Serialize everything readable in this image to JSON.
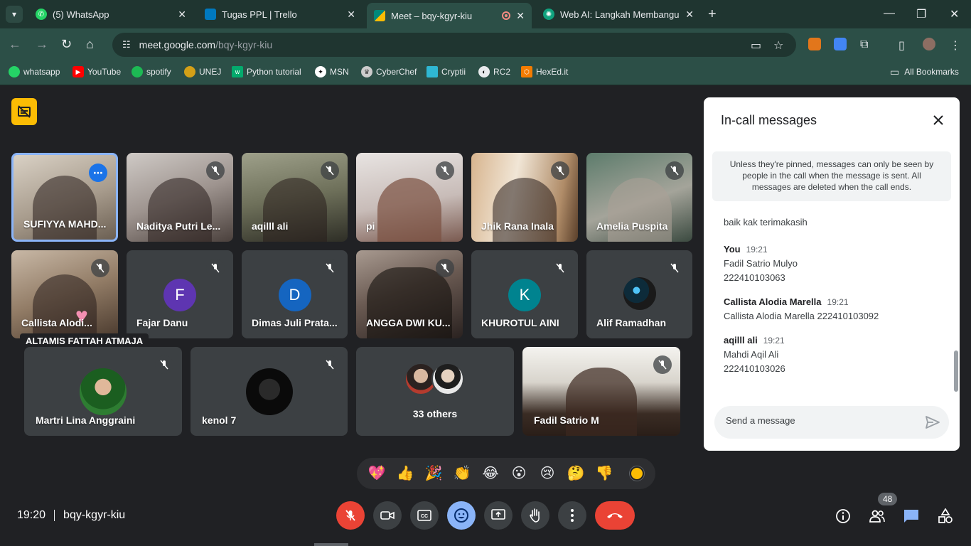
{
  "browser": {
    "tabs": [
      {
        "title": "(5) WhatsApp",
        "icon": "whatsapp-icon",
        "color": "#25d366"
      },
      {
        "title": "Tugas PPL | Trello",
        "icon": "trello-icon",
        "color": "#0079bf"
      },
      {
        "title": "Meet – bqy-kgyr-kiu",
        "icon": "meet-icon",
        "color": "#00897b"
      },
      {
        "title": "Web AI: Langkah Membangun",
        "icon": "openai-icon",
        "color": "#10a37f"
      }
    ],
    "url": {
      "host": "meet.google.com",
      "path": "/bqy-kgyr-kiu"
    },
    "bookmarks": [
      {
        "label": "whatsapp",
        "color": "#25d366"
      },
      {
        "label": "YouTube",
        "color": "#ff0000"
      },
      {
        "label": "spotify",
        "color": "#1db954"
      },
      {
        "label": "UNEJ",
        "color": "#d4a017"
      },
      {
        "label": "Python tutorial",
        "color": "#04aa6d"
      },
      {
        "label": "MSN",
        "color": "#ffffff"
      },
      {
        "label": "CyberChef",
        "color": "#cccccc"
      },
      {
        "label": "Cryptii",
        "color": "#2fb7d3"
      },
      {
        "label": "RC2",
        "color": "#e8eaed"
      },
      {
        "label": "HexEd.it",
        "color": "#f57c00"
      }
    ],
    "all_bookmarks": "All Bookmarks"
  },
  "participants": {
    "row1": [
      {
        "name": "SUFIYYA MAHD...",
        "style": "video-a",
        "speaking": true
      },
      {
        "name": "Naditya Putri Le...",
        "style": "video-b"
      },
      {
        "name": "aqilll ali",
        "style": "video-c"
      },
      {
        "name": "pi",
        "style": "video-d"
      },
      {
        "name": "Jhik Rana Inala",
        "style": "video-e"
      },
      {
        "name": "Amelia Puspita",
        "style": "video-f"
      }
    ],
    "row2": [
      {
        "name": "Callista Alodi...",
        "style": "video-g"
      },
      {
        "name": "Fajar Danu",
        "letter": "F",
        "color": "#5e35b1"
      },
      {
        "name": "Dimas Juli Prata...",
        "letter": "D",
        "color": "#1565c0"
      },
      {
        "name": "ANGGA DWI KU...",
        "style": "video-h"
      },
      {
        "name": "KHUROTUL AINI",
        "letter": "K",
        "color": "#00838f"
      },
      {
        "name": "Alif Ramadhan",
        "photo": true
      }
    ],
    "floating_label": "ALTAMIS FATTAH ATMAJA",
    "row3": [
      {
        "name": "Martri Lina Anggraini",
        "photo": "green"
      },
      {
        "name": "kenol 7",
        "photo": "dark"
      },
      {
        "name": "33 others",
        "others": true
      },
      {
        "name": "Fadil Satrio M",
        "style": "video-i"
      }
    ]
  },
  "chat": {
    "title": "In-call messages",
    "notice": "Unless they're pinned, messages can only be seen by people in the call when the message is sent. All messages are deleted when the call ends.",
    "first_line": "baik kak terimakasih",
    "messages": [
      {
        "sender": "You",
        "time": "19:21",
        "lines": [
          "Fadil Satrio Mulyo",
          "222410103063"
        ]
      },
      {
        "sender": "Callista Alodia Marella",
        "time": "19:21",
        "lines": [
          "Callista Alodia Marella 222410103092"
        ]
      },
      {
        "sender": "aqilll ali",
        "time": "19:21",
        "lines": [
          "Mahdi Aqil Ali",
          "222410103026"
        ]
      }
    ],
    "placeholder": "Send a message"
  },
  "reactions": [
    "💖",
    "👍",
    "🎉",
    "👏",
    "😂",
    "😮",
    "😢",
    "🤔",
    "👎"
  ],
  "meeting": {
    "time": "19:20",
    "code": "bqy-kgyr-kiu",
    "participant_count": "48"
  },
  "colors": {
    "accent": "#8ab4f8",
    "danger": "#ea4335",
    "panel": "#ffffff"
  }
}
